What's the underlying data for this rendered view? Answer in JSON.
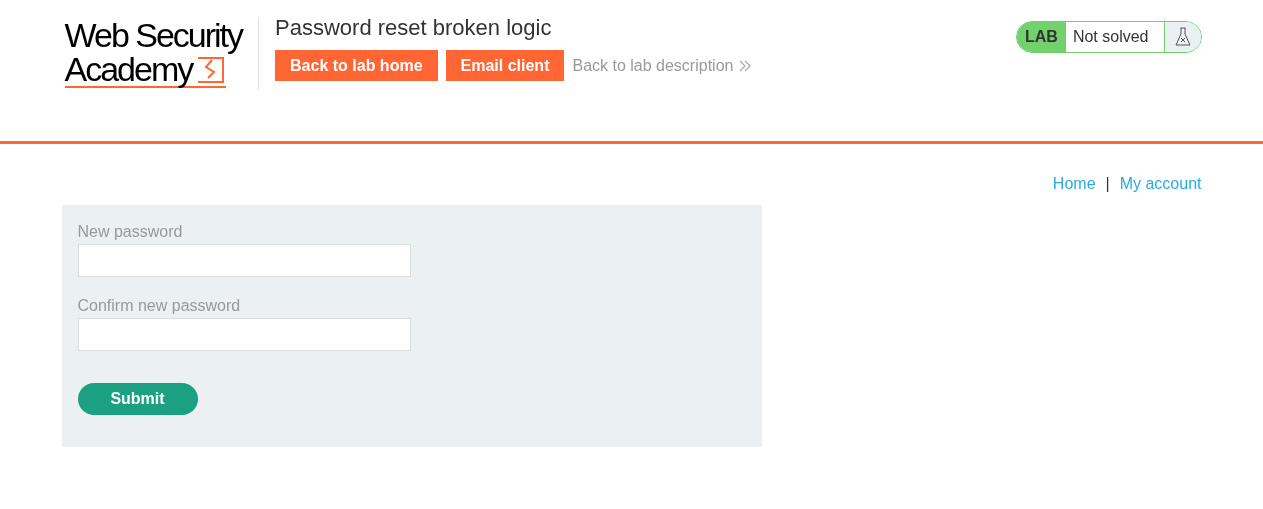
{
  "logo": {
    "line_1": "Web Security",
    "line_2": "Academy"
  },
  "lab_title": "Password reset broken logic",
  "header_buttons": [
    {
      "label": "Back to lab home",
      "kind": "button"
    },
    {
      "label": "Email client",
      "kind": "button"
    },
    {
      "label": "Back to lab description",
      "kind": "link"
    }
  ],
  "lab_status": {
    "badge": "LAB",
    "text": "Not solved",
    "solved": false
  },
  "nav": [
    "Home",
    "My account"
  ],
  "nav_separator": "|",
  "form": {
    "fields": [
      {
        "label": "New password"
      },
      {
        "label": "Confirm new password"
      }
    ],
    "submit": "Submit"
  }
}
